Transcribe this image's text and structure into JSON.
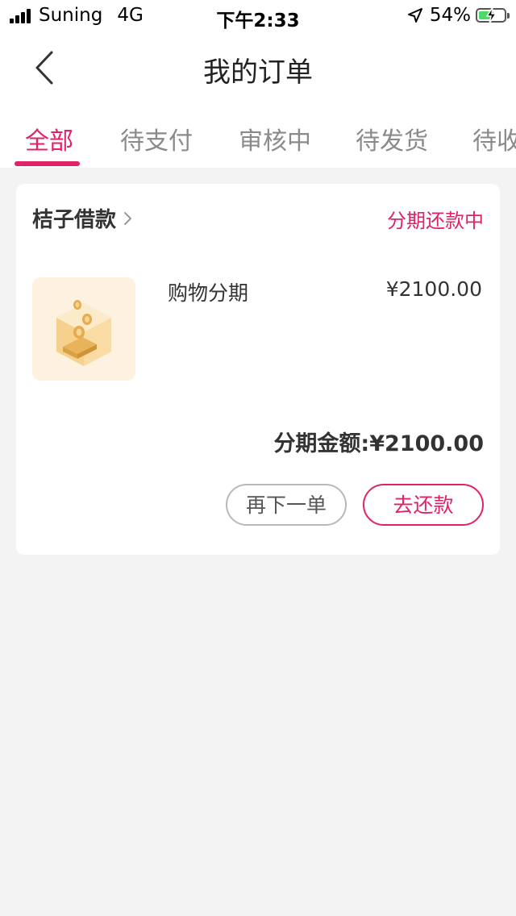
{
  "status_bar": {
    "carrier": "Suning",
    "network": "4G",
    "time": "下午2:33",
    "battery_percent": "54%",
    "battery_level": 0.54,
    "icons": [
      "signal-icon",
      "location-arrow-icon",
      "battery-charging-icon"
    ]
  },
  "nav": {
    "title": "我的订单",
    "back_icon": "chevron-left-icon"
  },
  "tabs": [
    {
      "label": "全部",
      "active": true
    },
    {
      "label": "待支付",
      "active": false
    },
    {
      "label": "审核中",
      "active": false
    },
    {
      "label": "待发货",
      "active": false
    },
    {
      "label": "待收",
      "active": false
    }
  ],
  "order": {
    "merchant": "桔子借款",
    "status": "分期还款中",
    "product_name": "购物分期",
    "product_price": "¥2100.00",
    "amount_label": "分期金额:¥2100.00",
    "buttons": {
      "reorder": "再下一单",
      "repay": "去还款"
    }
  },
  "colors": {
    "accent": "#e0226b",
    "background": "#f3f3f3",
    "card": "#ffffff",
    "thumb_bg": "#fdf1e0"
  }
}
